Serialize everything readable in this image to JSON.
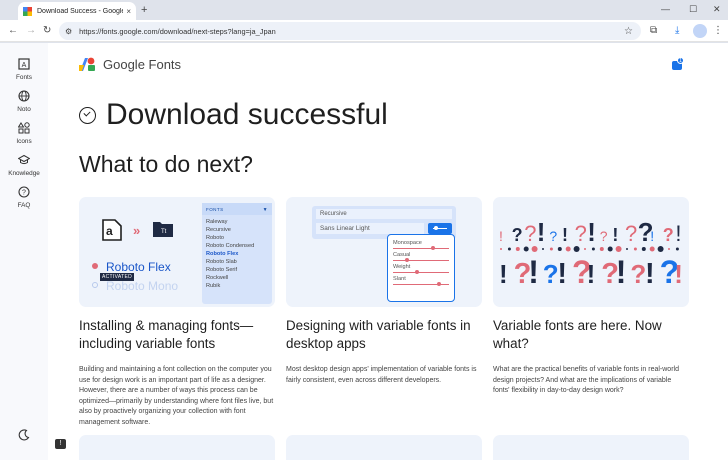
{
  "browser": {
    "tab_title": "Download Success - Google Fo",
    "tab_close": "×",
    "new_tab": "+",
    "url": "https://fonts.google.com/download/next-steps?lang=ja_Jpan",
    "min": "—",
    "max": "☐",
    "close": "✕"
  },
  "rail": {
    "items": [
      {
        "label": "Fonts",
        "icon": "fonts-icon"
      },
      {
        "label": "Noto",
        "icon": "globe-icon"
      },
      {
        "label": "Icons",
        "icon": "shapes-icon"
      },
      {
        "label": "Knowledge",
        "icon": "school-icon"
      },
      {
        "label": "FAQ",
        "icon": "help-icon"
      }
    ]
  },
  "header": {
    "logo_text": "Google Fonts",
    "cart_count": "1"
  },
  "main": {
    "headline": "Download successful",
    "subheading": "What to do next?",
    "cards": [
      {
        "title": "Installing & managing fonts—including variable fonts",
        "desc": "Building and maintaining a font collection on the computer you use for design work is an important part of life as a designer. However, there are a number of ways this process can be optimized—primarily by understanding where font files live, but also by proactively organizing your collection with font management software.",
        "illus": {
          "panel_header": "FONTS",
          "fonts": [
            "Raleway",
            "Recursive",
            "Roboto",
            "Roboto Condensed",
            "Roboto Flex",
            "Roboto Slab",
            "Roboto Serif",
            "Rockwell",
            "Rubik"
          ],
          "active_font": "Roboto Flex",
          "preview_font": "Roboto Flex",
          "preview_font_2": "Roboto Mono",
          "activated": "ACTIVATED",
          "folder_label": "Tt",
          "glyph": "a"
        }
      },
      {
        "title": "Designing with variable fonts in desktop apps",
        "desc": "Most desktop design apps' implementation of variable fonts is fairly consistent, even across different developers.",
        "illus": {
          "font_a": "Recursive",
          "font_b": "Sans Linear Light",
          "sliders": [
            "Monospace",
            "Casual",
            "Weight",
            "Slant"
          ]
        }
      },
      {
        "title": "Variable fonts are here. Now what?",
        "desc": "What are the practical benefits of variable fonts in real-world design projects? And what are the implications of variable fonts' flexibility in day-to-day design work?"
      }
    ]
  },
  "colors": {
    "blue": "#1a73e8",
    "pink": "#e06a77",
    "dark": "#1f2a44",
    "card_bg": "#eef3fb"
  }
}
